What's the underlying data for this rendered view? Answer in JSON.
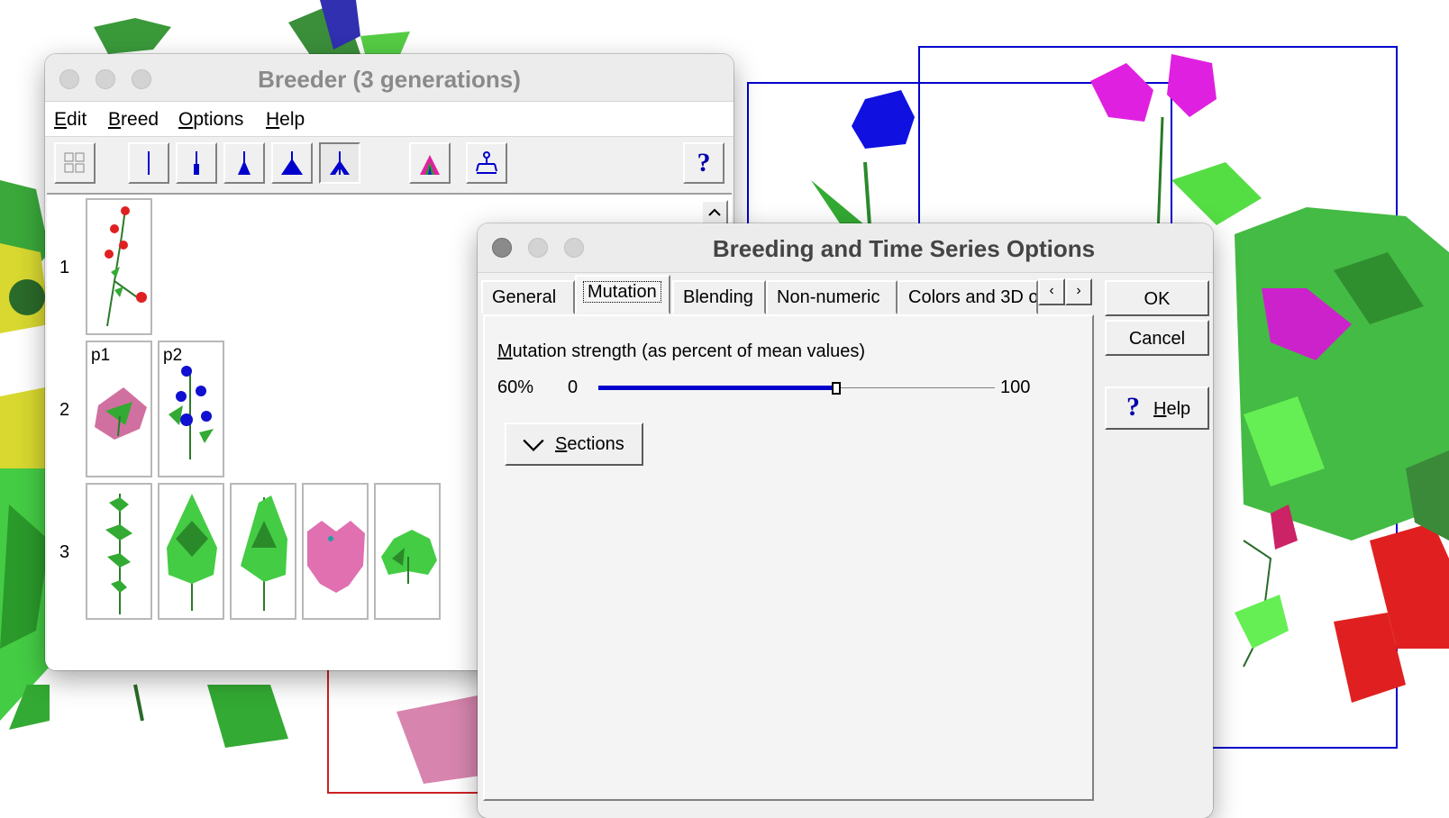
{
  "breeder_window": {
    "title": "Breeder (3 generations)",
    "menu": [
      {
        "key": "E",
        "rest": "dit"
      },
      {
        "key": "B",
        "rest": "reed"
      },
      {
        "key": "O",
        "rest": "ptions"
      },
      {
        "key": "H",
        "rest": "elp"
      }
    ],
    "toolbar_icons": [
      "grid-icon",
      "one-line-icon",
      "small-tree-icon",
      "medium-tree-icon",
      "large-tree-icon",
      "branching-tree-icon",
      "colored-tree-icon",
      "family-tree-icon",
      "help-icon"
    ],
    "help_glyph": "?",
    "generations": [
      {
        "label": "1",
        "plants": [
          {
            "label": ""
          }
        ]
      },
      {
        "label": "2",
        "plants": [
          {
            "label": "p1"
          },
          {
            "label": "p2"
          }
        ]
      },
      {
        "label": "3",
        "plants": [
          {
            "label": ""
          },
          {
            "label": ""
          },
          {
            "label": ""
          },
          {
            "label": ""
          },
          {
            "label": ""
          }
        ]
      }
    ]
  },
  "options_dialog": {
    "title": "Breeding and Time Series Options",
    "tabs": [
      "General",
      "Mutation",
      "Blending",
      "Non-numeric",
      "Colors and 3D o"
    ],
    "selected_tab": "Mutation",
    "mutation": {
      "label_key": "M",
      "label_rest": "utation strength (as percent of mean values)",
      "value_text": "60%",
      "min_label": "0",
      "max_label": "100",
      "value": 60,
      "min": 0,
      "max": 100
    },
    "sections": {
      "key": "S",
      "rest": "ections"
    },
    "buttons": {
      "ok": "OK",
      "cancel": "Cancel",
      "help_key": "H",
      "help_rest": "elp",
      "help_glyph": "?"
    },
    "tab_scroll": {
      "left": "‹",
      "right": "›"
    }
  },
  "colors": {
    "accent_blue": "#0000cc",
    "leaf_green": "#33cc33",
    "flower_magenta": "#e020e0",
    "flower_red": "#e02020",
    "flower_pink": "#d060a0"
  }
}
